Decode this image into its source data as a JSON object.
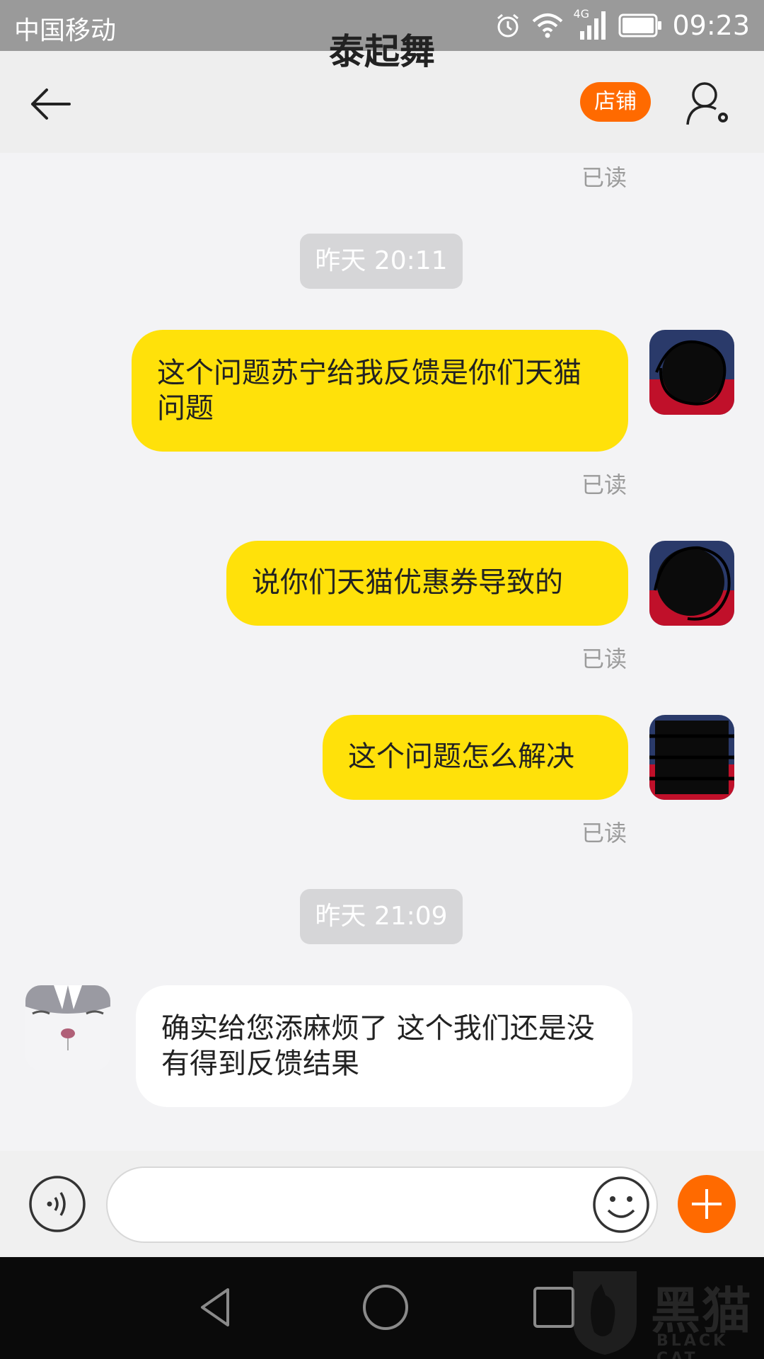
{
  "status_bar": {
    "carrier": "中国移动",
    "network": "4G",
    "time": "09:23"
  },
  "header": {
    "title": "泰起舞",
    "shop_label": "店铺"
  },
  "messages": {
    "read_0": "已读",
    "ts_1": "昨天  20:11",
    "out_1": "这个问题苏宁给我反馈是你们天猫问题",
    "read_1": "已读",
    "out_2": "说你们天猫优惠券导致的",
    "read_2": "已读",
    "out_3": "这个问题怎么解决",
    "read_3": "已读",
    "ts_2": "昨天  21:09",
    "in_1": "确实给您添麻烦了 这个我们还是没有得到反馈结果"
  },
  "input": {
    "placeholder": ""
  },
  "watermark": {
    "cn": "黑猫",
    "en": "BLACK CAT"
  },
  "colors": {
    "accent": "#ff6a00",
    "bubble_out": "#ffe10a",
    "bubble_in": "#ffffff",
    "nav": "#eeeeee"
  }
}
